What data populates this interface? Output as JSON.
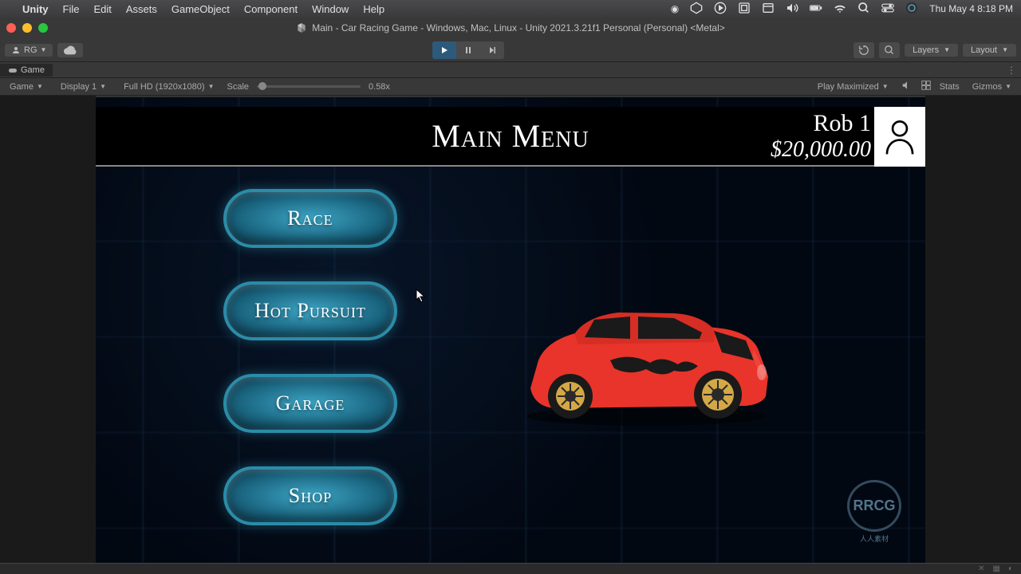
{
  "mac_menu": {
    "app": "Unity",
    "items": [
      "File",
      "Edit",
      "Assets",
      "GameObject",
      "Component",
      "Window",
      "Help"
    ],
    "datetime": "Thu May 4  8:18 PM"
  },
  "unity": {
    "title": "Main - Car Racing Game - Windows, Mac, Linux - Unity 2021.3.21f1 Personal (Personal) <Metal>",
    "account": "RG",
    "layers_label": "Layers",
    "layout_label": "Layout"
  },
  "game_tab": {
    "name": "Game"
  },
  "game_controls": {
    "mode": "Game",
    "display": "Display 1",
    "resolution": "Full HD (1920x1080)",
    "scale_label": "Scale",
    "scale_value": "0.58x",
    "play_maximized": "Play Maximized",
    "stats": "Stats",
    "gizmos": "Gizmos"
  },
  "game": {
    "title": "Main Menu",
    "player_name": "Rob 1",
    "player_money": "$20,000.00",
    "buttons": {
      "race": "Race",
      "hot_pursuit": "Hot Pursuit",
      "garage": "Garage",
      "shop": "Shop"
    }
  },
  "watermark": {
    "logo": "RRCG",
    "sub": "人人素材"
  }
}
